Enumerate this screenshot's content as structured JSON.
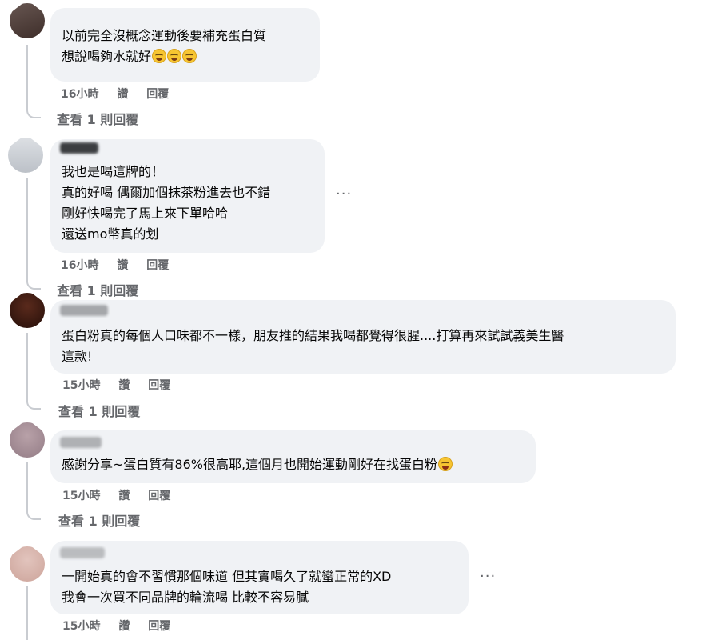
{
  "comments": [
    {
      "lines": [
        "以前完全沒概念運動後要補充蛋白質",
        "想說喝夠水就好"
      ],
      "emojis": [
        "grinning-smile-emoji",
        "grinning-smile-emoji",
        "grinning-smile-emoji"
      ],
      "time": "16小時",
      "like": "讚",
      "reply": "回覆",
      "view_replies": "查看 1 則回覆",
      "avatar_color": "#4a3a36"
    },
    {
      "lines": [
        "我也是喝這牌的！",
        "真的好喝 偶爾加個抹茶粉進去也不錯",
        "剛好快喝完了馬上來下單哈哈",
        "還送mo幣真的划"
      ],
      "time": "16小時",
      "like": "讚",
      "reply": "回覆",
      "view_replies": "查看 1 則回覆",
      "more": "···",
      "avatar_color": "#c8ccd2"
    },
    {
      "lines": [
        "蛋白粉真的每個人口味都不一樣，朋友推的結果我喝都覺得很腥....打算再來試試義美生醫",
        "這款!"
      ],
      "time": "15小時",
      "like": "讚",
      "reply": "回覆",
      "view_replies": "查看 1 則回覆",
      "avatar_color": "#3b1d14"
    },
    {
      "lines": [
        "感謝分享~蛋白質有86%很高耶,這個月也開始運動剛好在找蛋白粉"
      ],
      "emojis": [
        "laughing-tears-emoji"
      ],
      "time": "15小時",
      "like": "讚",
      "reply": "回覆",
      "view_replies": "查看 1 則回覆",
      "avatar_color": "#a78f96"
    },
    {
      "lines": [
        "一開始真的會不習慣那個味道 但其實喝久了就蠻正常的XD",
        "我會一次買不同品牌的輪流喝 比較不容易膩"
      ],
      "time": "15小時",
      "like": "讚",
      "reply": "回覆",
      "more": "···",
      "avatar_color": "#d7b4ac"
    }
  ]
}
